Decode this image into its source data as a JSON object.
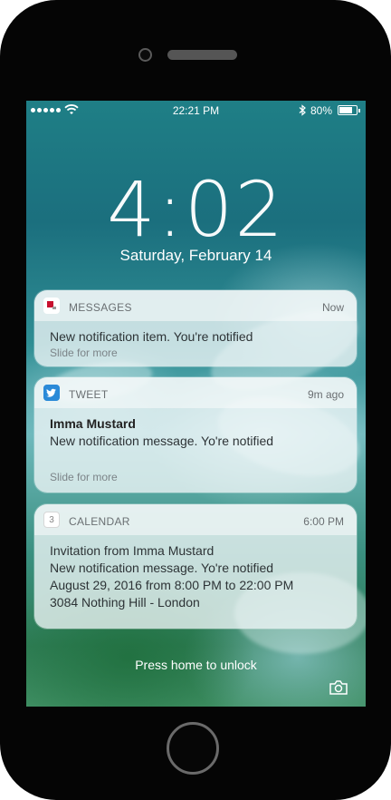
{
  "status_bar": {
    "time": "22:21 PM",
    "battery": "80%"
  },
  "lock_screen": {
    "clock": "4:02",
    "date": "Saturday, February 14",
    "unlock_hint": "Press home to unlock"
  },
  "notifications": [
    {
      "app": "MESSAGES",
      "icon": "messages-icon",
      "when": "Now",
      "sender": "",
      "lines": [
        "New notification item. You're notified"
      ],
      "hint": "Slide for more"
    },
    {
      "app": "TWEET",
      "icon": "twitter-icon",
      "when": "9m ago",
      "sender": "Imma Mustard",
      "lines": [
        "New notification message. Yo're notified"
      ],
      "hint": "Slide for more"
    },
    {
      "app": "CALENDAR",
      "icon": "calendar-icon",
      "icon_text": "3",
      "when": "6:00 PM",
      "sender": "Invitation from Imma Mustard",
      "lines": [
        "New notification message. Yo're notified",
        "August 29, 2016 from 8:00 PM to 22:00 PM",
        "3084 Nothing Hill - London"
      ],
      "hint": ""
    }
  ],
  "colors": {
    "twitter_blue": "#2a8ad8",
    "messages_red": "#c8102e"
  }
}
